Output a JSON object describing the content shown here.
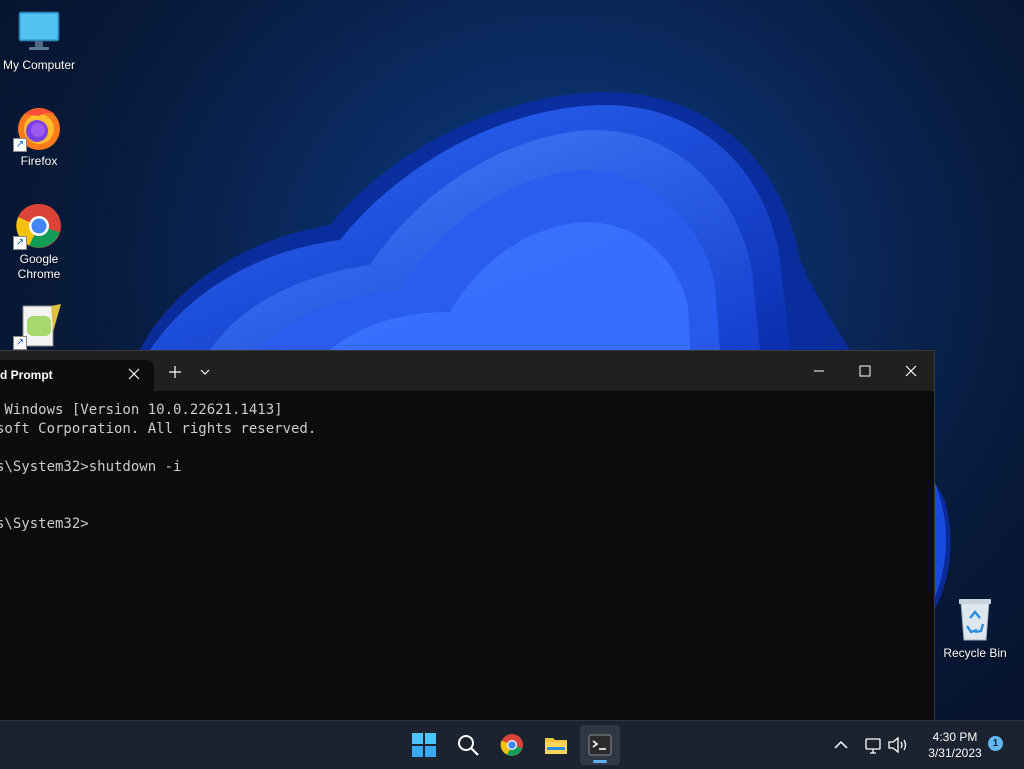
{
  "desktop": {
    "icons": [
      {
        "label": "My Computer"
      },
      {
        "label": "Firefox"
      },
      {
        "label": "Google Chrome"
      },
      {
        "label": ""
      }
    ],
    "recycle_bin": {
      "label": "Recycle Bin"
    }
  },
  "terminal": {
    "tab_title": "d Prompt",
    "lines": [
      " Windows [Version 10.0.22621.1413]",
      "soft Corporation. All rights reserved.",
      "",
      "s\\System32>shutdown -i",
      "",
      "",
      "s\\System32>"
    ],
    "colors": {
      "background": "#0c0c0c",
      "titlebar": "#202020",
      "text": "#cccccc"
    }
  },
  "taskbar": {
    "apps": [
      {
        "name": "start-icon"
      },
      {
        "name": "search-icon"
      },
      {
        "name": "chrome-icon"
      },
      {
        "name": "file-explorer-icon"
      },
      {
        "name": "terminal-icon",
        "active": true
      }
    ],
    "clock": {
      "time": "4:30 PM",
      "date": "3/31/2023"
    },
    "notification_count": "1",
    "accent": "#5fb2f2"
  }
}
